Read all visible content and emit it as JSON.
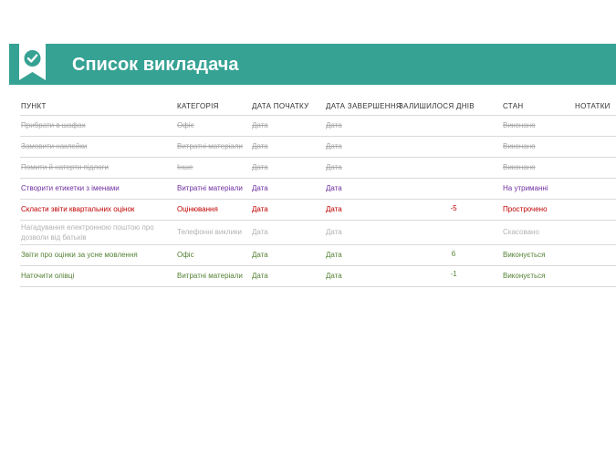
{
  "header": {
    "title": "Список викладача",
    "icon": "checkmark-bookmark-icon",
    "color": "#36a294"
  },
  "columns": {
    "item": "ПУНКТ",
    "category": "КАТЕГОРІЯ",
    "start": "ДАТА ПОЧАТКУ",
    "end": "ДАТА ЗАВЕРШЕННЯ",
    "days": "ЗАЛИШИЛОСЯ ДНІВ",
    "state": "СТАН",
    "notes": "НОТАТКИ"
  },
  "rows": [
    {
      "item": "Прибрати в шафах",
      "category": "Офіс",
      "start": "Дата",
      "end": "Дата",
      "days": "",
      "state": "Виконано"
    },
    {
      "item": "Замовити наклейки",
      "category": "Витратні матеріали",
      "start": "Дата",
      "end": "Дата",
      "days": "",
      "state": "Виконано"
    },
    {
      "item": "Помити й натерти підлоги",
      "category": "Інше",
      "start": "Дата",
      "end": "Дата",
      "days": "",
      "state": "Виконано"
    },
    {
      "item": "Створити етикетки з іменами",
      "category": "Витратні матеріали",
      "start": "Дата",
      "end": "Дата",
      "days": "",
      "state": "На утриманні"
    },
    {
      "item": "Скласти звіти квартальних оцінок",
      "category": "Оцінювання",
      "start": "Дата",
      "end": "Дата",
      "days": "-5",
      "state": "Прострочено"
    },
    {
      "item": "Нагадування електронною поштою про дозволи від батьків",
      "category": "Телефонні виклики",
      "start": "Дата",
      "end": "Дата",
      "days": "",
      "state": "Скасовано"
    },
    {
      "item": "Звіти про оцінки за усне мовлення",
      "category": "Офіс",
      "start": "Дата",
      "end": "Дата",
      "days": "6",
      "state": "Виконується"
    },
    {
      "item": "Наточити олівці",
      "category": "Витратні матеріали",
      "start": "Дата",
      "end": "Дата",
      "days": "-1",
      "state": "Виконується"
    }
  ],
  "colors": {
    "done": "#a6a6a6",
    "on_hold": "#7030a0",
    "overdue": "#c00000",
    "cancelled": "#b3b3b3",
    "in_progress": "#548235"
  }
}
